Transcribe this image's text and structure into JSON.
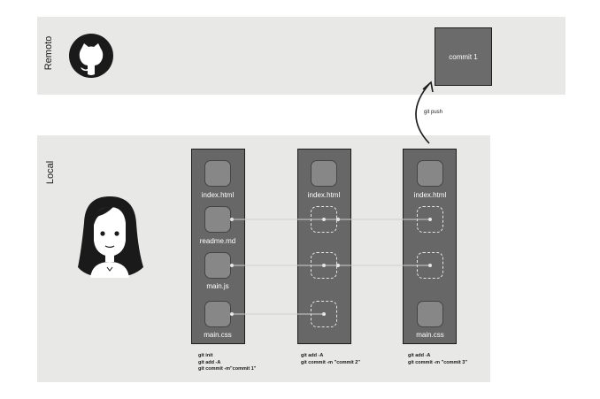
{
  "remote": {
    "label": "Remoto",
    "icon": "github-octocat-icon",
    "commit_label": "commit 1"
  },
  "push": {
    "label": "git push"
  },
  "local": {
    "label": "Local",
    "avatar": "developer-avatar-icon"
  },
  "columns": [
    {
      "files": {
        "index": "index.html",
        "readme": "readme.md",
        "main_js": "main.js",
        "main_css": "main.css"
      },
      "commands": [
        "git init",
        "git add -A",
        "git commit -m\"commit 1\""
      ]
    },
    {
      "files": {
        "index": "index.html"
      },
      "commands": [
        "git add -A",
        "git commit -m \"commit 2\""
      ]
    },
    {
      "files": {
        "index": "index.html",
        "main_css": "main.css"
      },
      "commands": [
        "git add -A",
        "git commit -m \"commit 3\""
      ]
    }
  ],
  "colors": {
    "band": "#e8e8e7",
    "column": "#676767",
    "file": "#878787",
    "link": "#cfcfcf"
  }
}
